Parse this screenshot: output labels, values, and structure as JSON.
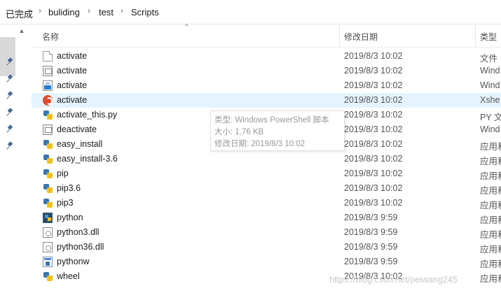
{
  "breadcrumb": {
    "items": [
      "已完成",
      "buliding",
      "test",
      "Scripts"
    ]
  },
  "columns": {
    "name": "名称",
    "date": "修改日期",
    "type": "类型"
  },
  "files": [
    {
      "name": "activate",
      "date": "2019/8/3 10:02",
      "type": "文件",
      "icon": "blank-file-icon"
    },
    {
      "name": "activate",
      "date": "2019/8/3 10:02",
      "type": "Wind",
      "icon": "batch-script-icon"
    },
    {
      "name": "activate",
      "date": "2019/8/3 10:02",
      "type": "Wind",
      "icon": "powershell-script-icon"
    },
    {
      "name": "activate",
      "date": "2019/8/3 10:02",
      "type": "Xshe",
      "icon": "xshell-icon"
    },
    {
      "name": "activate_this.py",
      "date": "2019/8/3 10:02",
      "type": "PY 文",
      "icon": "python-file-icon"
    },
    {
      "name": "deactivate",
      "date": "2019/8/3 10:02",
      "type": "Wind",
      "icon": "batch-script-icon"
    },
    {
      "name": "easy_install",
      "date": "2019/8/3 10:02",
      "type": "应用和",
      "icon": "python-file-icon"
    },
    {
      "name": "easy_install-3.6",
      "date": "2019/8/3 10:02",
      "type": "应用和",
      "icon": "python-file-icon"
    },
    {
      "name": "pip",
      "date": "2019/8/3 10:02",
      "type": "应用和",
      "icon": "python-file-icon"
    },
    {
      "name": "pip3.6",
      "date": "2019/8/3 10:02",
      "type": "应用和",
      "icon": "python-file-icon"
    },
    {
      "name": "pip3",
      "date": "2019/8/3 10:02",
      "type": "应用和",
      "icon": "python-file-icon"
    },
    {
      "name": "python",
      "date": "2019/8/3 9:59",
      "type": "应用和",
      "icon": "python-exe-icon"
    },
    {
      "name": "python3.dll",
      "date": "2019/8/3 9:59",
      "type": "应用和",
      "icon": "dll-file-icon"
    },
    {
      "name": "python36.dll",
      "date": "2019/8/3 9:59",
      "type": "应用和",
      "icon": "dll-file-icon"
    },
    {
      "name": "pythonw",
      "date": "2019/8/3 9:59",
      "type": "应用和",
      "icon": "pythonw-exe-icon"
    },
    {
      "name": "wheel",
      "date": "2019/8/3 10:02",
      "type": "应用和",
      "icon": "python-file-icon"
    }
  ],
  "selected_index": 3,
  "tooltip": {
    "line1": "类型: Windows PowerShell 脚本",
    "line2": "大小: 1.76 KB",
    "line3": "修改日期: 2019/8/3 10:02"
  },
  "watermark": "https://blog.csdn.net/peiwang245",
  "colors": {
    "selection": "#e5f3ff",
    "pin": "#4a6c93"
  }
}
